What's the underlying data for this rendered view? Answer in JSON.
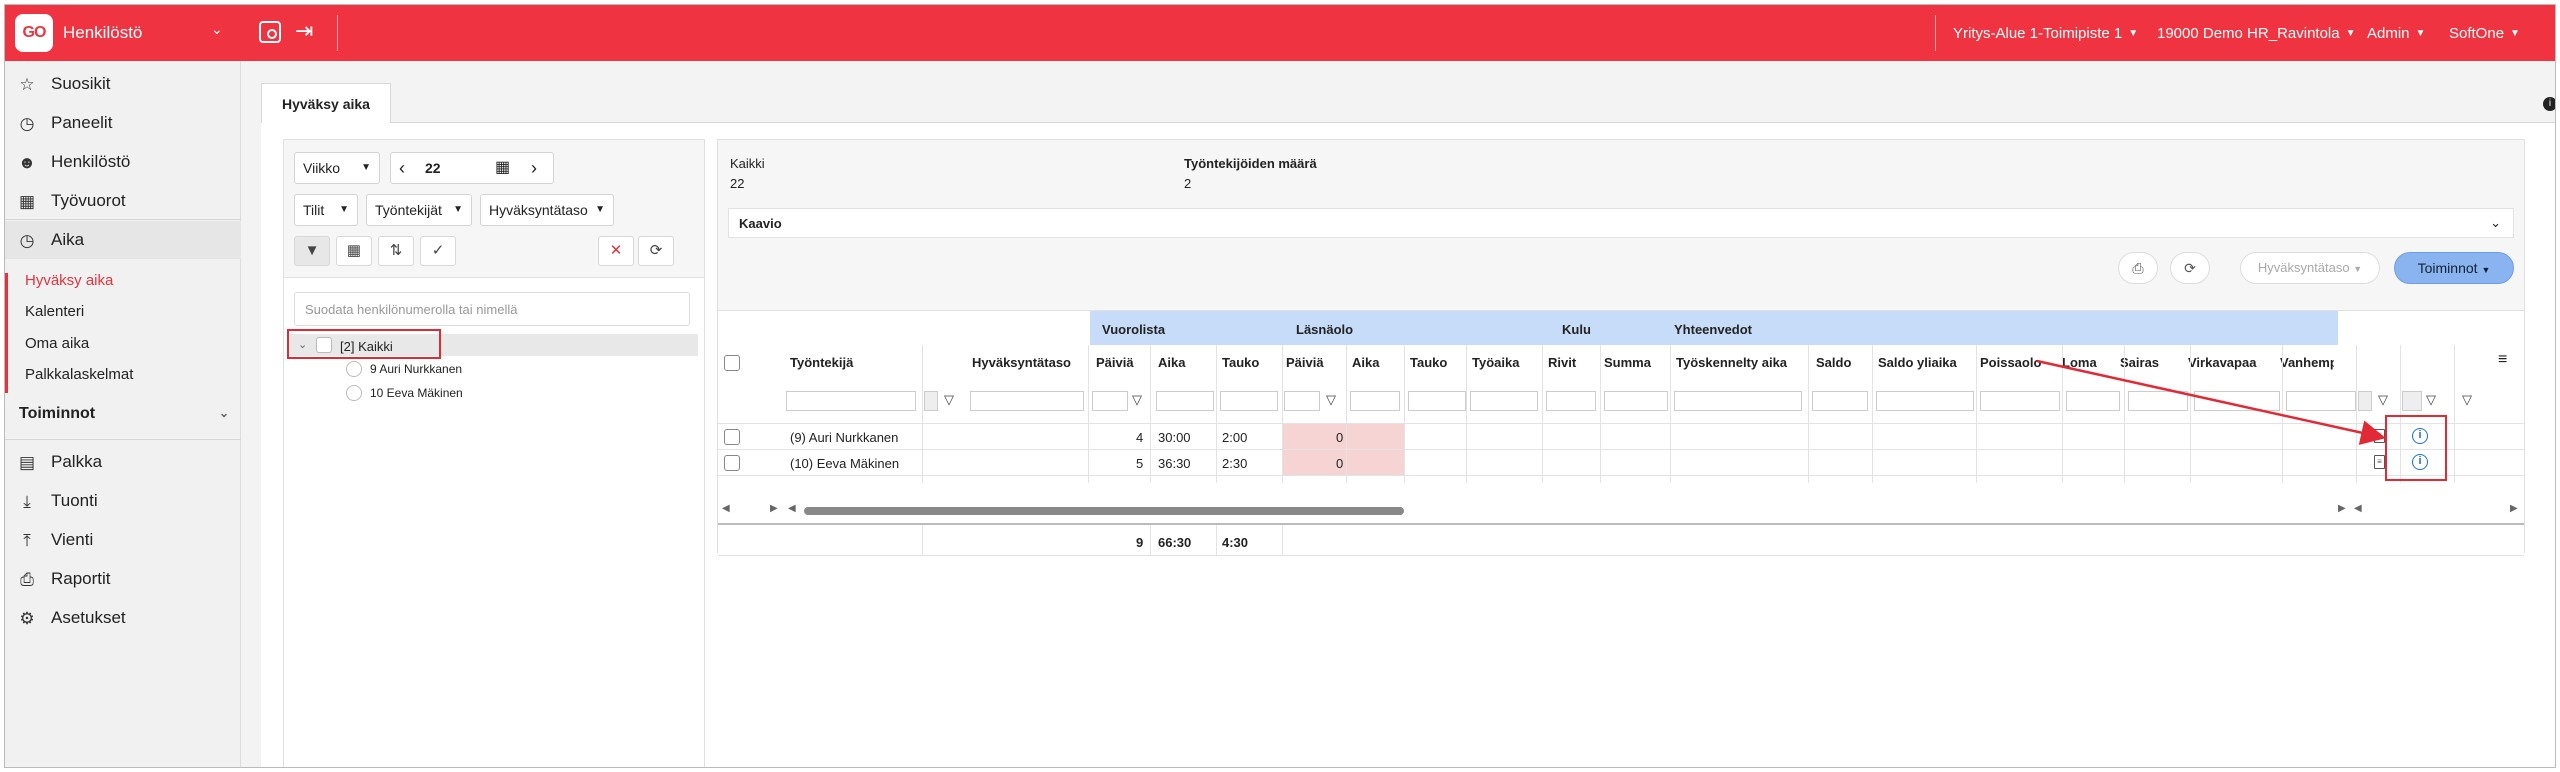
{
  "topbar": {
    "logo": "GO",
    "app_title": "Henkilöstö",
    "company": "Yritys-Alue 1-Toimipiste 1",
    "environment": "19000 Demo HR_Ravintola",
    "user": "Admin",
    "brand": "SoftOne"
  },
  "colors": {
    "accent": "#ef3340",
    "selection_blue": "#c7dcf8",
    "primary_button": "#8ab4f0",
    "warning_cell": "#f6d4d4",
    "highlight_box": "#e12a36"
  },
  "sidebar": {
    "items": [
      {
        "label": "Suosikit",
        "icon": "star-icon"
      },
      {
        "label": "Paneelit",
        "icon": "gauge-icon"
      },
      {
        "label": "Henkilöstö",
        "icon": "person-icon"
      },
      {
        "label": "Työvuorot",
        "icon": "calendar-icon"
      },
      {
        "label": "Aika",
        "icon": "clock-icon"
      }
    ],
    "subitems": [
      "Hyväksy aika",
      "Kalenteri",
      "Oma aika",
      "Palkkalaskelmat"
    ],
    "section": "Toiminnot",
    "items2": [
      {
        "label": "Palkka",
        "icon": "money-icon"
      },
      {
        "label": "Tuonti",
        "icon": "download-icon"
      },
      {
        "label": "Vienti",
        "icon": "upload-icon"
      },
      {
        "label": "Raportit",
        "icon": "printer-icon"
      },
      {
        "label": "Asetukset",
        "icon": "gear-icon"
      }
    ]
  },
  "tab": {
    "label": "Hyväksy aika"
  },
  "filters": {
    "period": "Viikko",
    "week": "22",
    "accounts": "Tilit",
    "employees": "Työntekijät",
    "approval_level": "Hyväksyntätaso",
    "search_placeholder": "Suodata henkilönumerolla tai nimellä"
  },
  "tree": {
    "root": "[2]  Kaikki",
    "children": [
      "9 Auri Nurkkanen",
      "10 Eeva Mäkinen"
    ]
  },
  "summary": {
    "label1": "Kaikki",
    "value1": "22",
    "label2": "Työntekijöiden määrä",
    "value2": "2",
    "chart_toggle": "Kaavio"
  },
  "actions": {
    "approval": "Hyväksyntätaso",
    "functions": "Toiminnot"
  },
  "grid": {
    "groups": [
      "Vuorolista",
      "Läsnäolo",
      "Kulu",
      "Yhteenvedot"
    ],
    "headers": [
      "Työntekijä",
      "Hyväksyntätaso",
      "Päiviä",
      "Aika",
      "Tauko",
      "Päiviä",
      "Aika",
      "Tauko",
      "Työaika",
      "Rivit",
      "Summa",
      "Työskennelty aika",
      "Saldo",
      "Saldo yliaika",
      "Poissaolo",
      "Loma",
      "Sairas",
      "Virkavapaa",
      "Vanhempainv"
    ],
    "rows": [
      {
        "employee": "(9) Auri Nurkkanen",
        "days": "4",
        "time": "30:00",
        "break": "2:00",
        "att_days": "0"
      },
      {
        "employee": "(10) Eeva Mäkinen",
        "days": "5",
        "time": "36:30",
        "break": "2:30",
        "att_days": "0"
      }
    ],
    "totals": {
      "days": "9",
      "time": "66:30",
      "break": "4:30"
    }
  }
}
